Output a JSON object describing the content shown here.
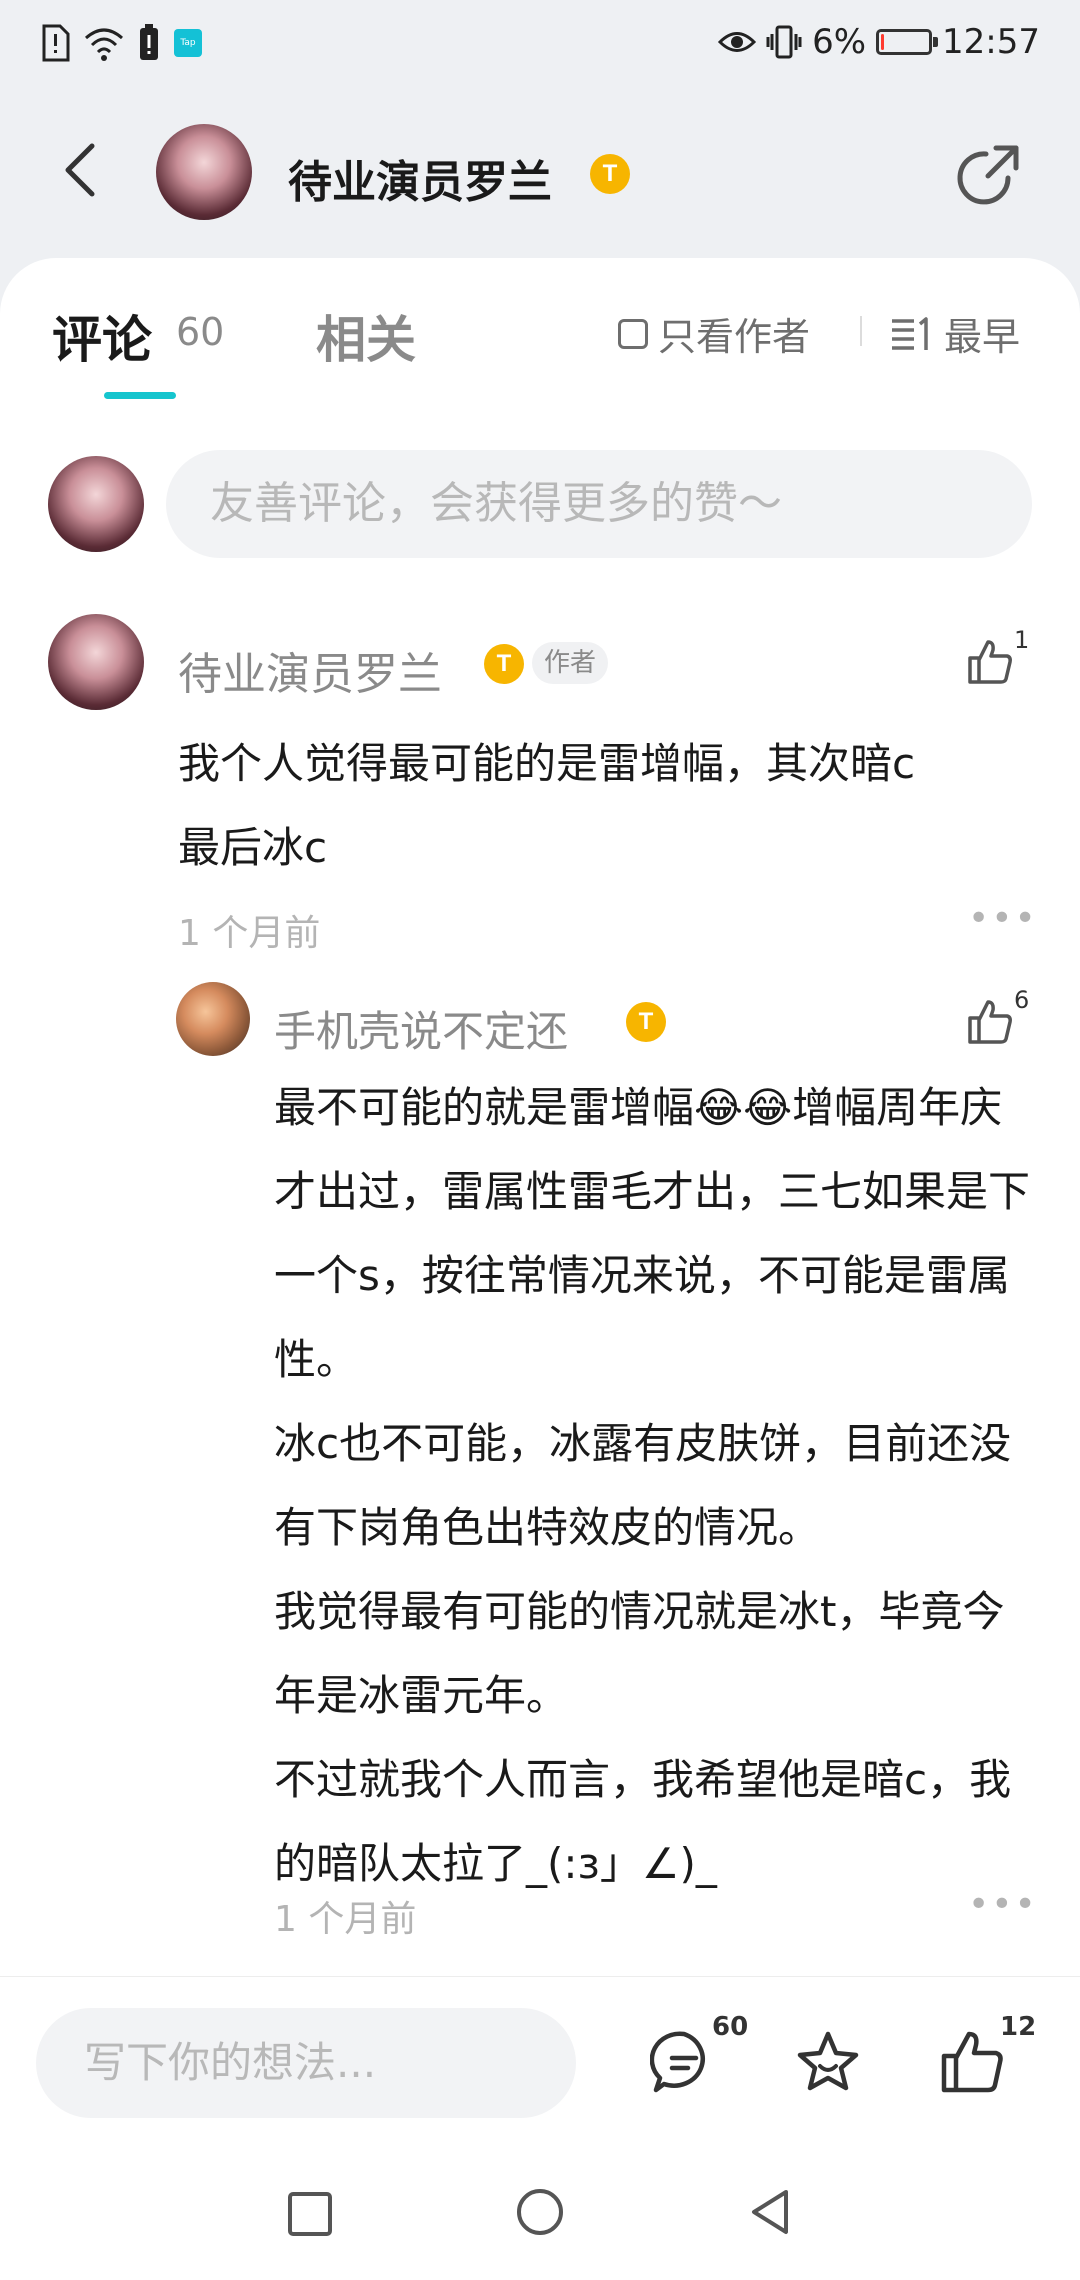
{
  "status_bar": {
    "battery_percent": "6%",
    "battery_level": 0.06,
    "time": "12:57",
    "tap_icon_label": "Tap"
  },
  "header": {
    "author_name": "待业演员罗兰",
    "badge_letter": "T"
  },
  "tabs": {
    "comments_label": "评论",
    "comments_count": "60",
    "related_label": "相关",
    "only_author_label": "只看作者",
    "sort_label": "最早"
  },
  "comment_input": {
    "placeholder": "友善评论，会获得更多的赞～"
  },
  "comment": {
    "author": "待业演员罗兰",
    "author_tag": "作者",
    "likes": "1",
    "text_line1": "我个人觉得最可能的是雷增幅，其次暗c",
    "text_line2": "最后冰c",
    "time": "1 个月前"
  },
  "reply": {
    "author": "手机壳说不定还",
    "likes": "6",
    "text": "最不可能的就是雷增幅😂😂增幅周年庆才出过，雷属性雷毛才出，三七如果是下一个s，按往常情况来说，不可能是雷属性。\n冰c也不可能，冰露有皮肤饼，目前还没有下岗角色出特效皮的情况。\n我觉得最有可能的情况就是冰t，毕竟今年是冰雷元年。\n不过就我个人而言，我希望他是暗c，我的暗队太拉了_(:з」∠)_",
    "time": "1 个月前"
  },
  "bottom_bar": {
    "input_placeholder": "写下你的想法...",
    "comment_count": "60",
    "like_count": "12"
  },
  "colors": {
    "accent": "#15c5ce",
    "badge": "#f7b500"
  }
}
